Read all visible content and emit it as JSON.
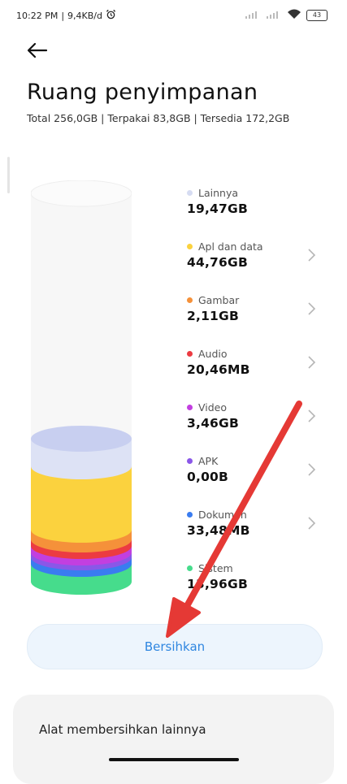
{
  "status_bar": {
    "time": "10:22 PM",
    "network_speed": "9,4KB/d",
    "battery": "43"
  },
  "header": {
    "title": "Ruang penyimpanan",
    "subtitle": "Total 256,0GB | Terpakai 83,8GB | Tersedia 172,2GB"
  },
  "categories": [
    {
      "name": "Lainnya",
      "value": "19,47GB",
      "color": "#d6dcf2"
    },
    {
      "name": "Apl dan data",
      "value": "44,76GB",
      "color": "#fbd23e"
    },
    {
      "name": "Gambar",
      "value": "2,11GB",
      "color": "#f5913a"
    },
    {
      "name": "Audio",
      "value": "20,46MB",
      "color": "#ec3b42"
    },
    {
      "name": "Video",
      "value": "3,46GB",
      "color": "#c23fe0"
    },
    {
      "name": "APK",
      "value": "0,00B",
      "color": "#8a57e8"
    },
    {
      "name": "Dokumen",
      "value": "33,48MB",
      "color": "#3a7cf0"
    },
    {
      "name": "Sistem",
      "value": "13,96GB",
      "color": "#46dc8c"
    }
  ],
  "actions": {
    "clean_label": "Bersihkan",
    "more_tools_label": "Alat membersihkan lainnya"
  },
  "annotation_color": "#e53935"
}
